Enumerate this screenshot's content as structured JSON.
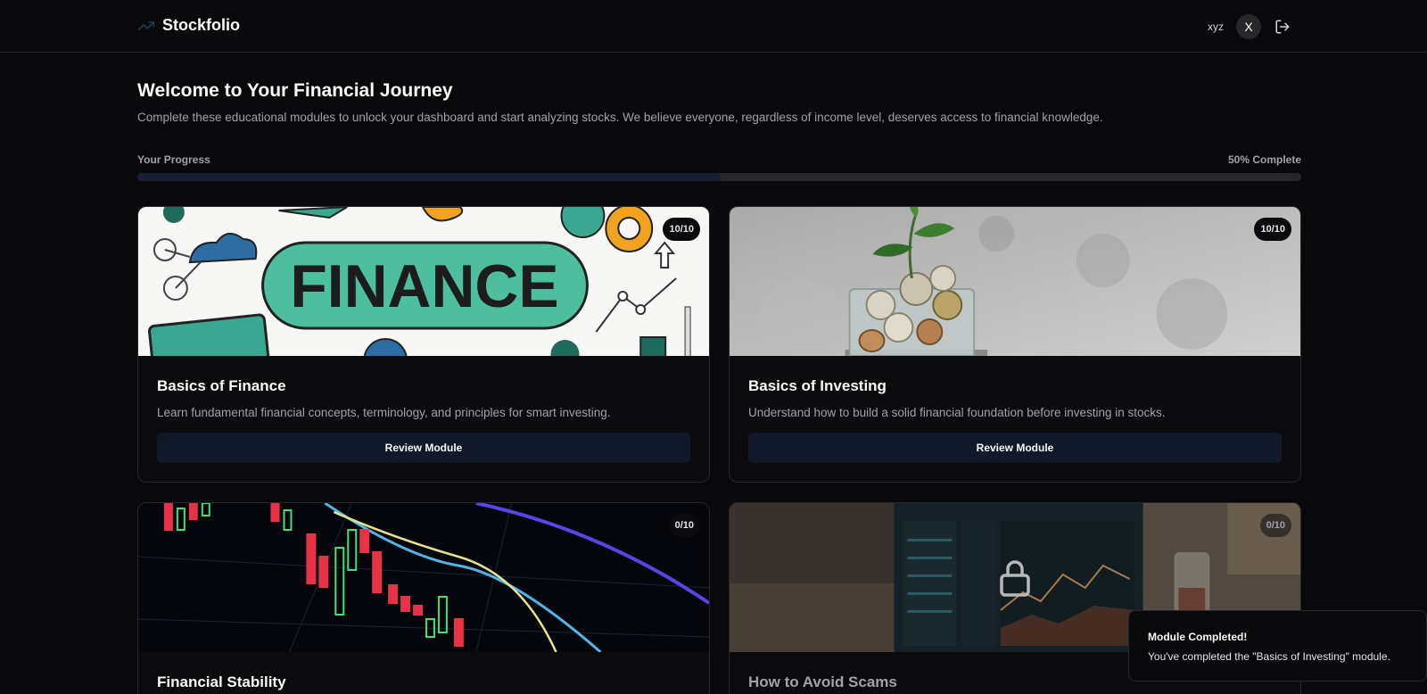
{
  "header": {
    "brand": "Stockfolio",
    "username": "xyz",
    "avatar_initial": "X"
  },
  "intro": {
    "title": "Welcome to Your Financial Journey",
    "subtitle": "Complete these educational modules to unlock your dashboard and start analyzing stocks. We believe everyone, regardless of income level, deserves access to financial knowledge."
  },
  "progress": {
    "label": "Your Progress",
    "value_text": "50% Complete",
    "fraction": 0.5
  },
  "modules": [
    {
      "title": "Basics of Finance",
      "description": "Learn fundamental financial concepts, terminology, and principles for smart investing.",
      "score": "10/10",
      "button": "Review Module",
      "image_text": "FINANCE"
    },
    {
      "title": "Basics of Investing",
      "description": "Understand how to build a solid financial foundation before investing in stocks.",
      "score": "10/10",
      "button": "Review Module"
    },
    {
      "title": "Financial Stability",
      "score": "0/10"
    },
    {
      "title": "How to Avoid Scams",
      "score": "0/10",
      "locked": true
    }
  ],
  "toast": {
    "title": "Module Completed!",
    "message": "You've completed the \"Basics of Investing\" module."
  },
  "colors": {
    "background": "#09090b",
    "border": "#27272a",
    "button_bg": "#111827",
    "progress_fill": "#172033"
  }
}
